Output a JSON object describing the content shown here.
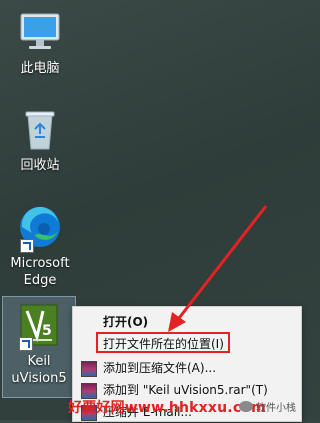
{
  "desktop": {
    "icons": [
      {
        "label": "此电脑",
        "icon": "computer-icon"
      },
      {
        "label": "回收站",
        "icon": "recycle-bin-icon"
      },
      {
        "label": "Microsoft Edge",
        "icon": "edge-icon"
      },
      {
        "label": "Keil uVision5",
        "icon": "keil-uvision-icon"
      }
    ]
  },
  "context_menu": {
    "items": [
      {
        "label": "打开(O)"
      },
      {
        "label": "打开文件所在的位置(I)"
      },
      {
        "label": "添加到压缩文件(A)..."
      },
      {
        "label": "添加到 \"Keil uVision5.rar\"(T)"
      },
      {
        "label": "压缩并 E-mail..."
      }
    ]
  },
  "annotation": {
    "highlight_color": "#e52222",
    "arrow_color": "#e52222"
  },
  "watermark": {
    "url": "好要好网www.hhkxxu.com",
    "wechat": "软件小栈"
  }
}
